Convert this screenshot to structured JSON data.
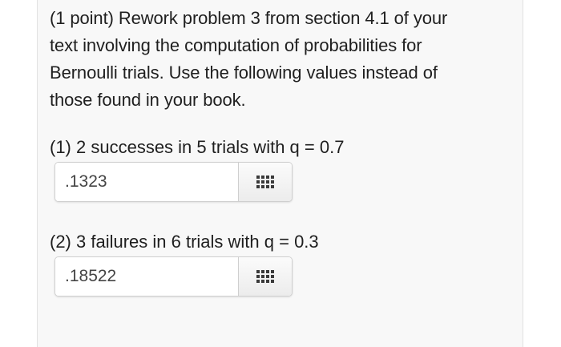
{
  "problem": {
    "line1": "(1 point) Rework problem 3 from section 4.1 of your",
    "line2": "text involving the computation of probabilities for",
    "line3": "Bernoulli trials. Use the following values instead of",
    "line4": "those found in your book."
  },
  "parts": [
    {
      "label": "(1) 2 successes in 5 trials with q = 0.7",
      "answer_value": ".1323",
      "palette_icon": "equation-palette-icon"
    },
    {
      "label": "(2) 3 failures in 6 trials with q = 0.3",
      "answer_value": ".18522",
      "palette_icon": "equation-palette-icon"
    }
  ],
  "colors": {
    "text": "#1f1f1f",
    "card_background": "#f8f8f8",
    "input_border": "#cfcfcf"
  }
}
